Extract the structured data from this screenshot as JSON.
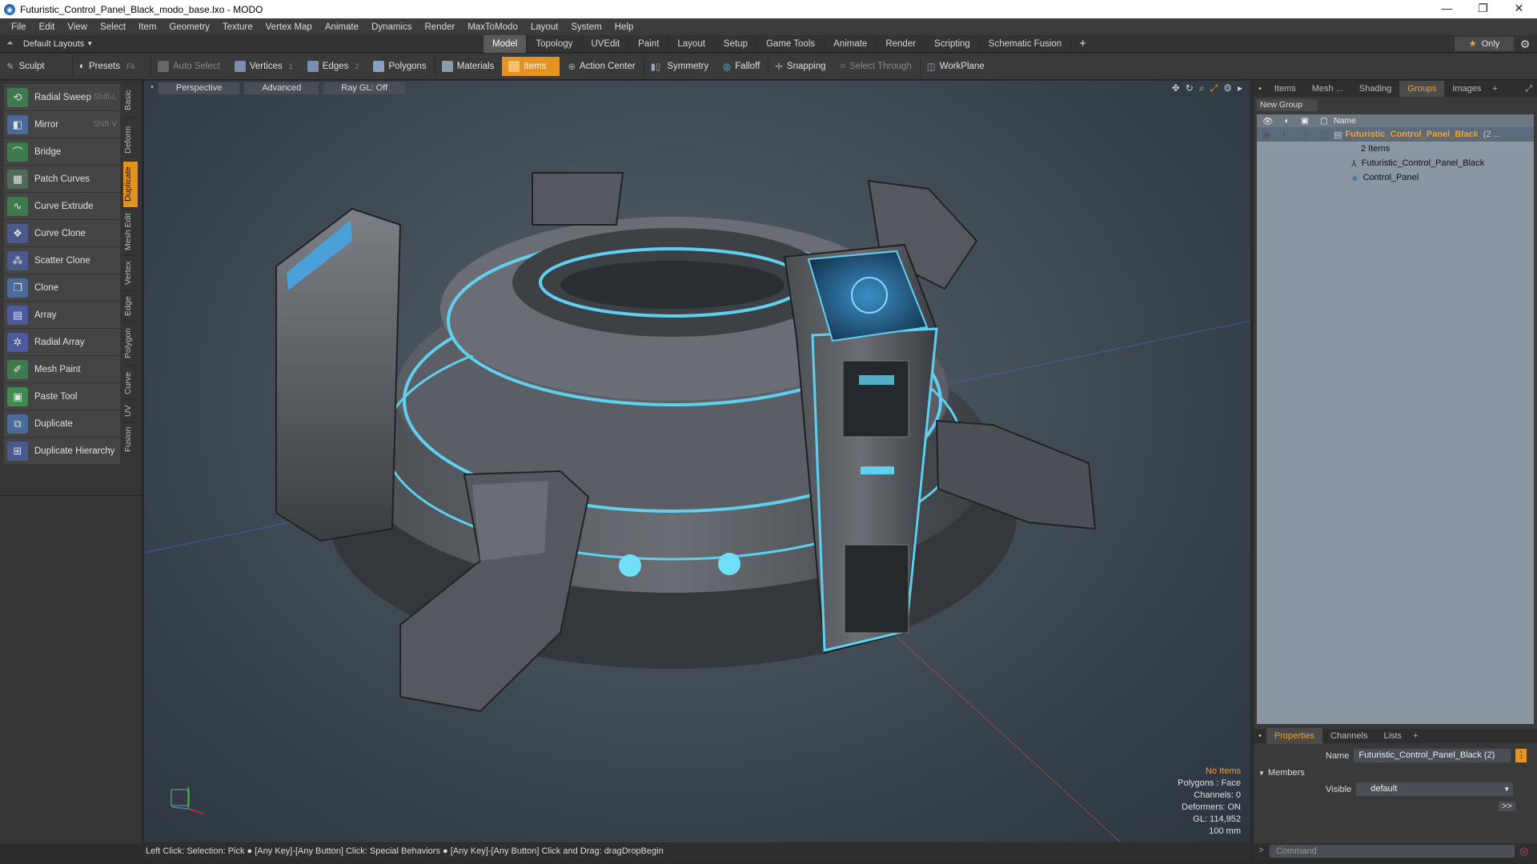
{
  "window": {
    "title": "Futuristic_Control_Panel_Black_modo_base.lxo - MODO"
  },
  "menu": [
    "File",
    "Edit",
    "View",
    "Select",
    "Item",
    "Geometry",
    "Texture",
    "Vertex Map",
    "Animate",
    "Dynamics",
    "Render",
    "MaxToModo",
    "Layout",
    "System",
    "Help"
  ],
  "layout": {
    "dropdown": "Default Layouts",
    "tabs": [
      "Model",
      "Topology",
      "UVEdit",
      "Paint",
      "Layout",
      "Setup",
      "Game Tools",
      "Animate",
      "Render",
      "Scripting",
      "Schematic Fusion"
    ],
    "active_tab": "Model",
    "only_label": "Only"
  },
  "toolbar": {
    "sculpt": "Sculpt",
    "presets": "Presets",
    "presets_key": "F6",
    "auto_select": "Auto Select",
    "vertices": "Vertices",
    "vertices_count": "1",
    "edges": "Edges",
    "edges_count": "2",
    "polygons": "Polygons",
    "materials": "Materials",
    "items": "Items",
    "action_center": "Action Center",
    "symmetry": "Symmetry",
    "falloff": "Falloff",
    "snapping": "Snapping",
    "select_through": "Select Through",
    "workplane": "WorkPlane"
  },
  "tools": [
    {
      "label": "Radial Sweep",
      "shortcut": "Shift-L"
    },
    {
      "label": "Mirror",
      "shortcut": "Shift-V"
    },
    {
      "label": "Bridge",
      "shortcut": ""
    },
    {
      "label": "Patch Curves",
      "shortcut": ""
    },
    {
      "label": "Curve Extrude",
      "shortcut": ""
    },
    {
      "label": "Curve Clone",
      "shortcut": ""
    },
    {
      "label": "Scatter Clone",
      "shortcut": ""
    },
    {
      "label": "Clone",
      "shortcut": ""
    },
    {
      "label": "Array",
      "shortcut": ""
    },
    {
      "label": "Radial Array",
      "shortcut": ""
    },
    {
      "label": "Mesh Paint",
      "shortcut": ""
    },
    {
      "label": "Paste Tool",
      "shortcut": ""
    },
    {
      "label": "Duplicate",
      "shortcut": ""
    },
    {
      "label": "Duplicate Hierarchy",
      "shortcut": ""
    }
  ],
  "vertical_tabs": [
    "Basic",
    "Deform",
    "Duplicate",
    "Mesh Edit",
    "Vertex",
    "Edge",
    "Polygon",
    "Curve",
    "UV",
    "Fusion"
  ],
  "active_vertical_tab": "Duplicate",
  "viewport": {
    "view": "Perspective",
    "shading": "Advanced",
    "raygl": "Ray GL: Off",
    "info": {
      "selection": "No Items",
      "polygons": "Polygons : Face",
      "channels": "Channels: 0",
      "deformers": "Deformers: ON",
      "gl": "GL: 114,952",
      "scale": "100 mm"
    }
  },
  "right_panel": {
    "tabs": [
      "Items",
      "Mesh ...",
      "Shading",
      "Groups",
      "Images"
    ],
    "active_tab": "Groups",
    "new_group": "New Group",
    "col_name": "Name",
    "group_name": "Futuristic_Control_Panel_Black",
    "group_suffix": "(2 ...",
    "group_count": "2 Items",
    "children": [
      "Futuristic_Control_Panel_Black",
      "Control_Panel"
    ],
    "props_tabs": [
      "Properties",
      "Channels",
      "Lists"
    ],
    "name_label": "Name",
    "name_value": "Futuristic_Control_Panel_Black (2)",
    "members_label": "Members",
    "visible_label": "Visible",
    "visible_value": "default"
  },
  "status": "Left Click: Selection: Pick ● [Any Key]-[Any Button] Click: Special Behaviors ● [Any Key]-[Any Button] Click and Drag: dragDropBegin",
  "command_placeholder": "Command",
  "colors": {
    "accent": "#e49222",
    "panel": "#3a3a3a",
    "glow": "#5fd0f0"
  }
}
